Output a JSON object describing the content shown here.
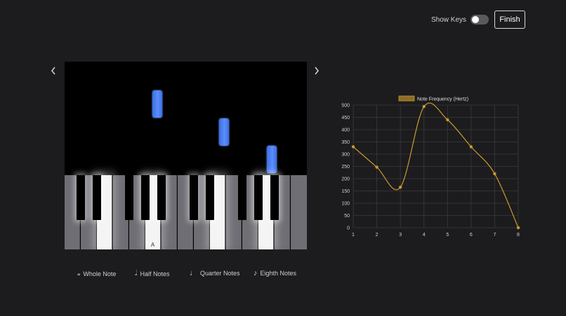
{
  "header": {
    "show_keys_label": "Show Keys",
    "show_keys_on": false,
    "finish_label": "Finish"
  },
  "navigation": {
    "prev_icon": "chevron-left-icon",
    "next_icon": "chevron-right-icon"
  },
  "piano": {
    "key_label": "A",
    "note_color": "#4f7df2"
  },
  "legend": [
    {
      "icon": "whole-note-icon",
      "glyph": "𝅝",
      "label": "Whole Note"
    },
    {
      "icon": "half-note-icon",
      "glyph": "𝅗𝅥",
      "label": "Half Notes"
    },
    {
      "icon": "quarter-note-icon",
      "glyph": "♩",
      "label": "Quarter Notes"
    },
    {
      "icon": "eighth-note-icon",
      "glyph": "♪",
      "label": "Eighth Notes"
    }
  ],
  "chart_data": {
    "type": "line",
    "x": [
      1,
      2,
      3,
      4,
      5,
      6,
      7,
      8
    ],
    "series": [
      {
        "name": "Note Frequency (Hertz)",
        "values": [
          330,
          247,
          165,
          494,
          440,
          330,
          220,
          0
        ],
        "color": "#c99a2e"
      }
    ],
    "ylim": [
      0,
      500
    ],
    "yticks": [
      0,
      50,
      100,
      150,
      200,
      250,
      300,
      350,
      400,
      450,
      500
    ],
    "grid": true,
    "legend_position": "top"
  }
}
